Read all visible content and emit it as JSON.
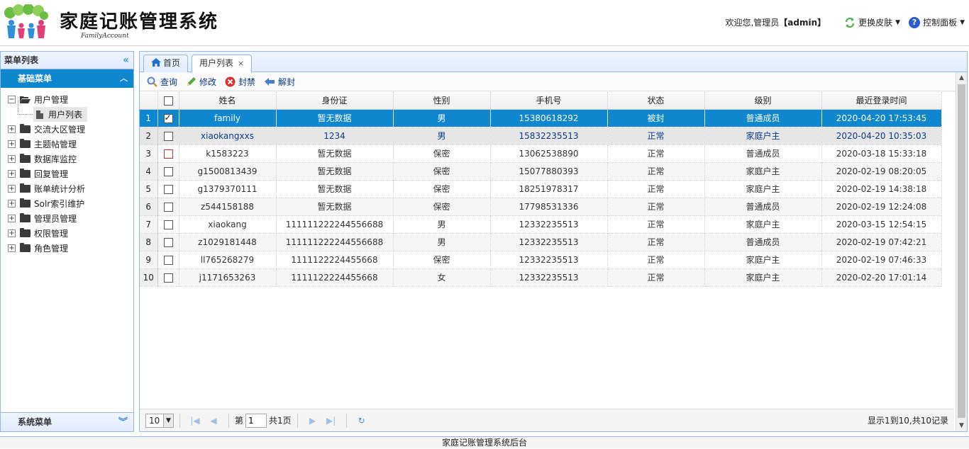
{
  "header": {
    "title": "家庭记账管理系统",
    "subtitle": "FamilyAccount",
    "welcome_prefix": "欢迎您,管理员",
    "username": "【admin】",
    "skin_menu": "更换皮肤",
    "control_panel": "控制面板",
    "colors": {
      "logo_green": "#6cbd45",
      "logo_blue": "#2f8fd8",
      "logo_pink": "#e0407a"
    }
  },
  "sidebar": {
    "title": "菜单列表",
    "basic_menu": "基础菜单",
    "system_menu": "系统菜单",
    "tree": [
      {
        "label": "用户管理",
        "expanded": true,
        "children": [
          {
            "label": "用户列表"
          }
        ]
      },
      {
        "label": "交流大区管理"
      },
      {
        "label": "主题帖管理"
      },
      {
        "label": "数据库监控"
      },
      {
        "label": "回复管理"
      },
      {
        "label": "账单统计分析"
      },
      {
        "label": "Solr索引维护"
      },
      {
        "label": "管理员管理"
      },
      {
        "label": "权限管理"
      },
      {
        "label": "角色管理"
      }
    ]
  },
  "tabs": [
    {
      "label": "首页",
      "icon": "home-icon"
    },
    {
      "label": "用户列表",
      "closable": true,
      "active": true
    }
  ],
  "toolbar": {
    "query": "查询",
    "edit": "修改",
    "ban": "封禁",
    "unban": "解封"
  },
  "grid": {
    "columns": [
      "姓名",
      "身份证",
      "性别",
      "手机号",
      "状态",
      "级别",
      "最近登录时间"
    ],
    "rows": [
      {
        "n": "1",
        "name": "family",
        "id": "暂无数据",
        "sex": "男",
        "phone": "15380618292",
        "status": "被封",
        "level": "普通成员",
        "login": "2020-04-20 17:53:45",
        "checked": true,
        "selected": true
      },
      {
        "n": "2",
        "name": "xiaokangxxs",
        "id": "1234",
        "sex": "男",
        "phone": "15832235513",
        "status": "正常",
        "level": "家庭户主",
        "login": "2020-04-20 10:35:03"
      },
      {
        "n": "3",
        "name": "k1583223",
        "id": "暂无数据",
        "sex": "保密",
        "phone": "13062538890",
        "status": "正常",
        "level": "普通成员",
        "login": "2020-03-18 15:33:18"
      },
      {
        "n": "4",
        "name": "g1500813439",
        "id": "暂无数据",
        "sex": "保密",
        "phone": "15077880393",
        "status": "正常",
        "level": "家庭户主",
        "login": "2020-02-19 08:20:05"
      },
      {
        "n": "5",
        "name": "g1379370111",
        "id": "暂无数据",
        "sex": "保密",
        "phone": "18251978317",
        "status": "正常",
        "level": "家庭户主",
        "login": "2020-02-19 14:38:18"
      },
      {
        "n": "6",
        "name": "z544158188",
        "id": "暂无数据",
        "sex": "保密",
        "phone": "17798531336",
        "status": "正常",
        "level": "普通成员",
        "login": "2020-02-19 12:24:08"
      },
      {
        "n": "7",
        "name": "xiaokang",
        "id": "111111222244556688",
        "sex": "男",
        "phone": "12332235513",
        "status": "正常",
        "level": "家庭户主",
        "login": "2020-03-15 12:54:15"
      },
      {
        "n": "8",
        "name": "z1029181448",
        "id": "111111222244556688",
        "sex": "男",
        "phone": "12332235513",
        "status": "正常",
        "level": "普通成员",
        "login": "2020-02-19 07:42:21"
      },
      {
        "n": "9",
        "name": "ll765268279",
        "id": "1111122224455668",
        "sex": "保密",
        "phone": "12332235513",
        "status": "正常",
        "level": "家庭户主",
        "login": "2020-02-19 07:46:33"
      },
      {
        "n": "10",
        "name": "j1171653263",
        "id": "1111122224455668",
        "sex": "女",
        "phone": "12332235513",
        "status": "正常",
        "level": "家庭户主",
        "login": "2020-02-20 17:01:14"
      }
    ]
  },
  "pager": {
    "page_size": "10",
    "page_prefix": "第",
    "page_value": "1",
    "page_suffix": "共1页",
    "info": "显示1到10,共10记录"
  },
  "footer": {
    "text": "家庭记账管理系统后台"
  },
  "colors": {
    "selected_row": "#0e87cf",
    "panel_border": "#95b8e7",
    "accent_blue": "#4a8dd8"
  }
}
